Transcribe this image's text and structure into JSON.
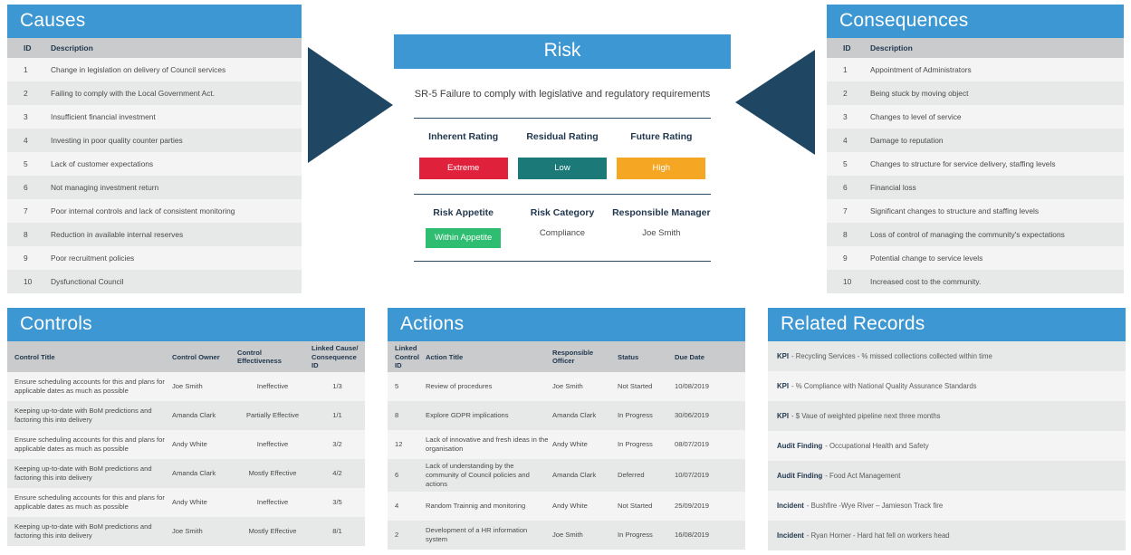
{
  "colors": {
    "brand_blue": "#3C97D3",
    "arrow_navy": "#1F4662",
    "header_gray": "#C9CBCC",
    "extreme_red": "#E0213C",
    "low_teal": "#1B7A78",
    "high_amber": "#F5A623",
    "appetite_green": "#2EBD71"
  },
  "causes": {
    "title": "Causes",
    "columns": [
      "ID",
      "Description"
    ],
    "rows": [
      [
        "1",
        "Change in legislation on delivery of Council services"
      ],
      [
        "2",
        "Failing to comply with the Local Government Act."
      ],
      [
        "3",
        "Insufficient financial investment"
      ],
      [
        "4",
        "Investing in poor quality counter parties"
      ],
      [
        "5",
        "Lack of customer expectations"
      ],
      [
        "6",
        "Not managing investment return"
      ],
      [
        "7",
        "Poor internal controls and lack of consistent monitoring"
      ],
      [
        "8",
        "Reduction in available internal reserves"
      ],
      [
        "9",
        "Poor recruitment policies"
      ],
      [
        "10",
        "Dysfunctional Council"
      ]
    ]
  },
  "consequences": {
    "title": "Consequences",
    "columns": [
      "ID",
      "Description"
    ],
    "rows": [
      [
        "1",
        "Appointment of Administrators"
      ],
      [
        "2",
        "Being stuck by moving object"
      ],
      [
        "3",
        "Changes to level of service"
      ],
      [
        "4",
        "Damage to reputation"
      ],
      [
        "5",
        "Changes to structure for service delivery, staffing levels"
      ],
      [
        "6",
        "Financial loss"
      ],
      [
        "7",
        "Significant changes to structure and staffing levels"
      ],
      [
        "8",
        "Loss of control of managing the community's expectations"
      ],
      [
        "9",
        "Potential change to service levels"
      ],
      [
        "10",
        "Increased cost to the community."
      ]
    ]
  },
  "risk": {
    "title": "Risk",
    "statement": "SR-5 Failure to comply with legislative and regulatory requirements",
    "ratings": [
      {
        "label": "Inherent Rating",
        "value": "Extreme",
        "color": "#E0213C"
      },
      {
        "label": "Residual Rating",
        "value": "Low",
        "color": "#1B7A78"
      },
      {
        "label": "Future Rating",
        "value": "High",
        "color": "#F5A623"
      }
    ],
    "meta": [
      {
        "label": "Risk Appetite",
        "value": "Within Appetite",
        "chip": true,
        "color": "#2EBD71"
      },
      {
        "label": "Risk Category",
        "value": "Compliance",
        "chip": false
      },
      {
        "label": "Responsible Manager",
        "value": "Joe Smith",
        "chip": false
      }
    ]
  },
  "controls": {
    "title": "Controls",
    "columns": [
      "Control Title",
      "Control Owner",
      "Control Effectiveness",
      "Linked Cause/ Consequence ID"
    ],
    "rows": [
      [
        "Ensure scheduling accounts for this and plans for applicable dates as much as possible",
        "Joe Smith",
        "Ineffective",
        "1/3"
      ],
      [
        "Keeping up-to-date with BoM predictions and factoring this into delivery",
        "Amanda Clark",
        "Partially Effective",
        "1/1"
      ],
      [
        "Ensure scheduling accounts for this and plans for applicable dates as much as possible",
        "Andy White",
        "Ineffective",
        "3/2"
      ],
      [
        "Keeping up-to-date with BoM predictions and factoring this into delivery",
        "Amanda Clark",
        "Mostly Effective",
        "4/2"
      ],
      [
        "Ensure scheduling accounts for this and plans for applicable dates as much as possible",
        "Andy White",
        "Ineffective",
        "3/5"
      ],
      [
        "Keeping up-to-date with BoM predictions and factoring this into delivery",
        "Joe Smith",
        "Mostly Effective",
        "8/1"
      ]
    ]
  },
  "actions": {
    "title": "Actions",
    "columns": [
      "Linked Control ID",
      "Action Title",
      "Responsible Officer",
      "Status",
      "Due Date"
    ],
    "rows": [
      [
        "5",
        "Review of procedures",
        "Joe Smith",
        "Not Started",
        "10/08/2019"
      ],
      [
        "8",
        "Explore GDPR implications",
        "Amanda Clark",
        "In Progress",
        "30/06/2019"
      ],
      [
        "12",
        "Lack of innovative and fresh ideas in the organisation",
        "Andy White",
        "In Progress",
        "08/07/2019"
      ],
      [
        "6",
        "Lack of understanding by the community of Council policies and actions",
        "Amanda Clark",
        "Deferred",
        "10/07/2019"
      ],
      [
        "4",
        "Random Trainnig and monitoring",
        "Andy White",
        "Not Started",
        "25/09/2019"
      ],
      [
        "2",
        "Development of a HR information system",
        "Joe Smith",
        "In Progress",
        "16/08/2019"
      ]
    ]
  },
  "related_records": {
    "title": "Related Records",
    "items": [
      {
        "type": "KPI",
        "text": "- Recycling Services - % missed collections collected within time"
      },
      {
        "type": "KPI",
        "text": "- % Compliance with National Quality Assurance Standards"
      },
      {
        "type": "KPI",
        "text": "- $ Vaue of weighted pipeline next three months"
      },
      {
        "type": "Audit Finding",
        "text": "- Occupational Health and Safety"
      },
      {
        "type": "Audit Finding",
        "text": "- Food Act Management"
      },
      {
        "type": "Incident",
        "text": "- Bushfire -Wye River – Jamieson Track fire"
      },
      {
        "type": "Incident",
        "text": "- Ryan Horner - Hard hat fell on workers head"
      }
    ]
  }
}
